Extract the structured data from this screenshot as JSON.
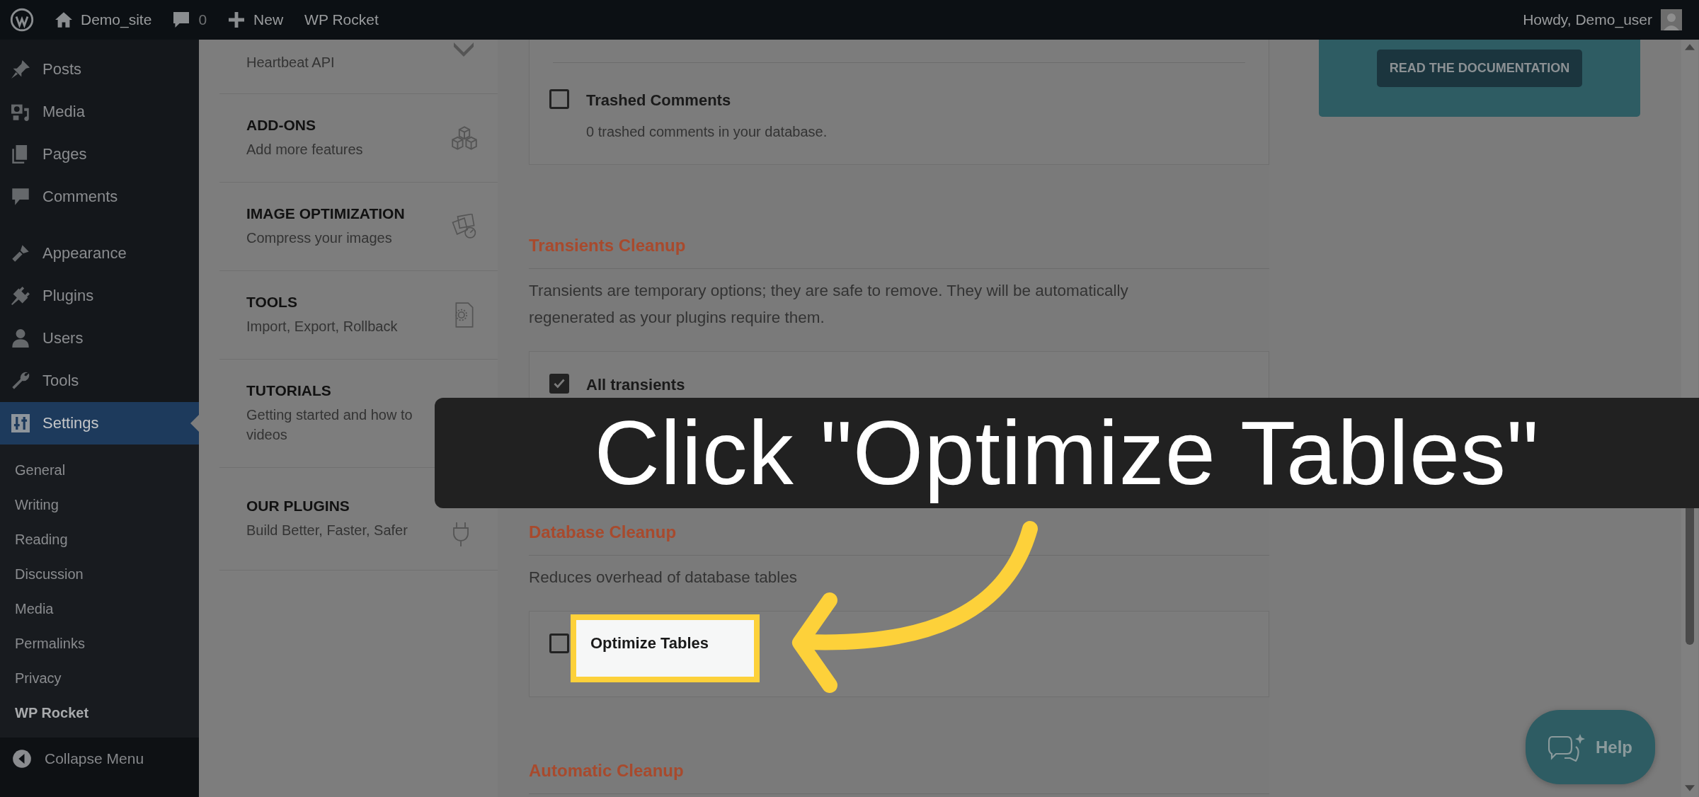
{
  "topbar": {
    "site": "Demo_site",
    "comments": "0",
    "new": "New",
    "plugin": "WP Rocket",
    "greeting": "Howdy, Demo_user"
  },
  "sidebar": {
    "groups": [
      [
        {
          "label": "Posts",
          "selected": false
        },
        {
          "label": "Media",
          "selected": false
        },
        {
          "label": "Pages",
          "selected": false
        },
        {
          "label": "Comments",
          "selected": false
        }
      ],
      [
        {
          "label": "Appearance",
          "selected": false
        },
        {
          "label": "Plugins",
          "selected": false
        },
        {
          "label": "Users",
          "selected": false
        },
        {
          "label": "Tools",
          "selected": false
        },
        {
          "label": "Settings",
          "selected": true
        }
      ]
    ],
    "submenu": [
      {
        "label": "General",
        "selected": false
      },
      {
        "label": "Writing",
        "selected": false
      },
      {
        "label": "Reading",
        "selected": false
      },
      {
        "label": "Discussion",
        "selected": false
      },
      {
        "label": "Media",
        "selected": false
      },
      {
        "label": "Permalinks",
        "selected": false
      },
      {
        "label": "Privacy",
        "selected": false
      },
      {
        "label": "WP Rocket",
        "selected": true
      }
    ],
    "collapse": "Collapse Menu"
  },
  "rocket_nav": [
    {
      "description": "Heartbeat API"
    },
    {
      "title": "ADD-ONS",
      "description": "Add more features"
    },
    {
      "title": "IMAGE OPTIMIZATION",
      "description": "Compress your images"
    },
    {
      "title": "TOOLS",
      "description": "Import, Export, Rollback"
    },
    {
      "title": "TUTORIALS",
      "description": "Getting started and how to videos"
    },
    {
      "title": "OUR PLUGINS",
      "description": "Build Better, Faster, Safer"
    }
  ],
  "top_card": {
    "options": [
      {
        "label": "Trashed Comments",
        "description": "0 trashed comments in your database.",
        "checked": false,
        "highlighted": false
      }
    ]
  },
  "sections": [
    {
      "heading": "Transients Cleanup",
      "description": "Transients are temporary options; they are safe to remove. They will be automatically regenerated as your plugins require them.",
      "options": [
        {
          "label": "All transients",
          "checked": true,
          "highlighted": false
        }
      ]
    },
    {
      "heading": "Database Cleanup",
      "description": "Reduces overhead of database tables",
      "options": [
        {
          "label": "Optimize Tables",
          "checked": false,
          "highlighted": true
        }
      ]
    },
    {
      "heading": "Automatic Cleanup"
    }
  ],
  "doc_button": "READ THE DOCUMENTATION",
  "help_button": "Help",
  "tutorial": {
    "caption": "Click \"Optimize Tables\""
  }
}
